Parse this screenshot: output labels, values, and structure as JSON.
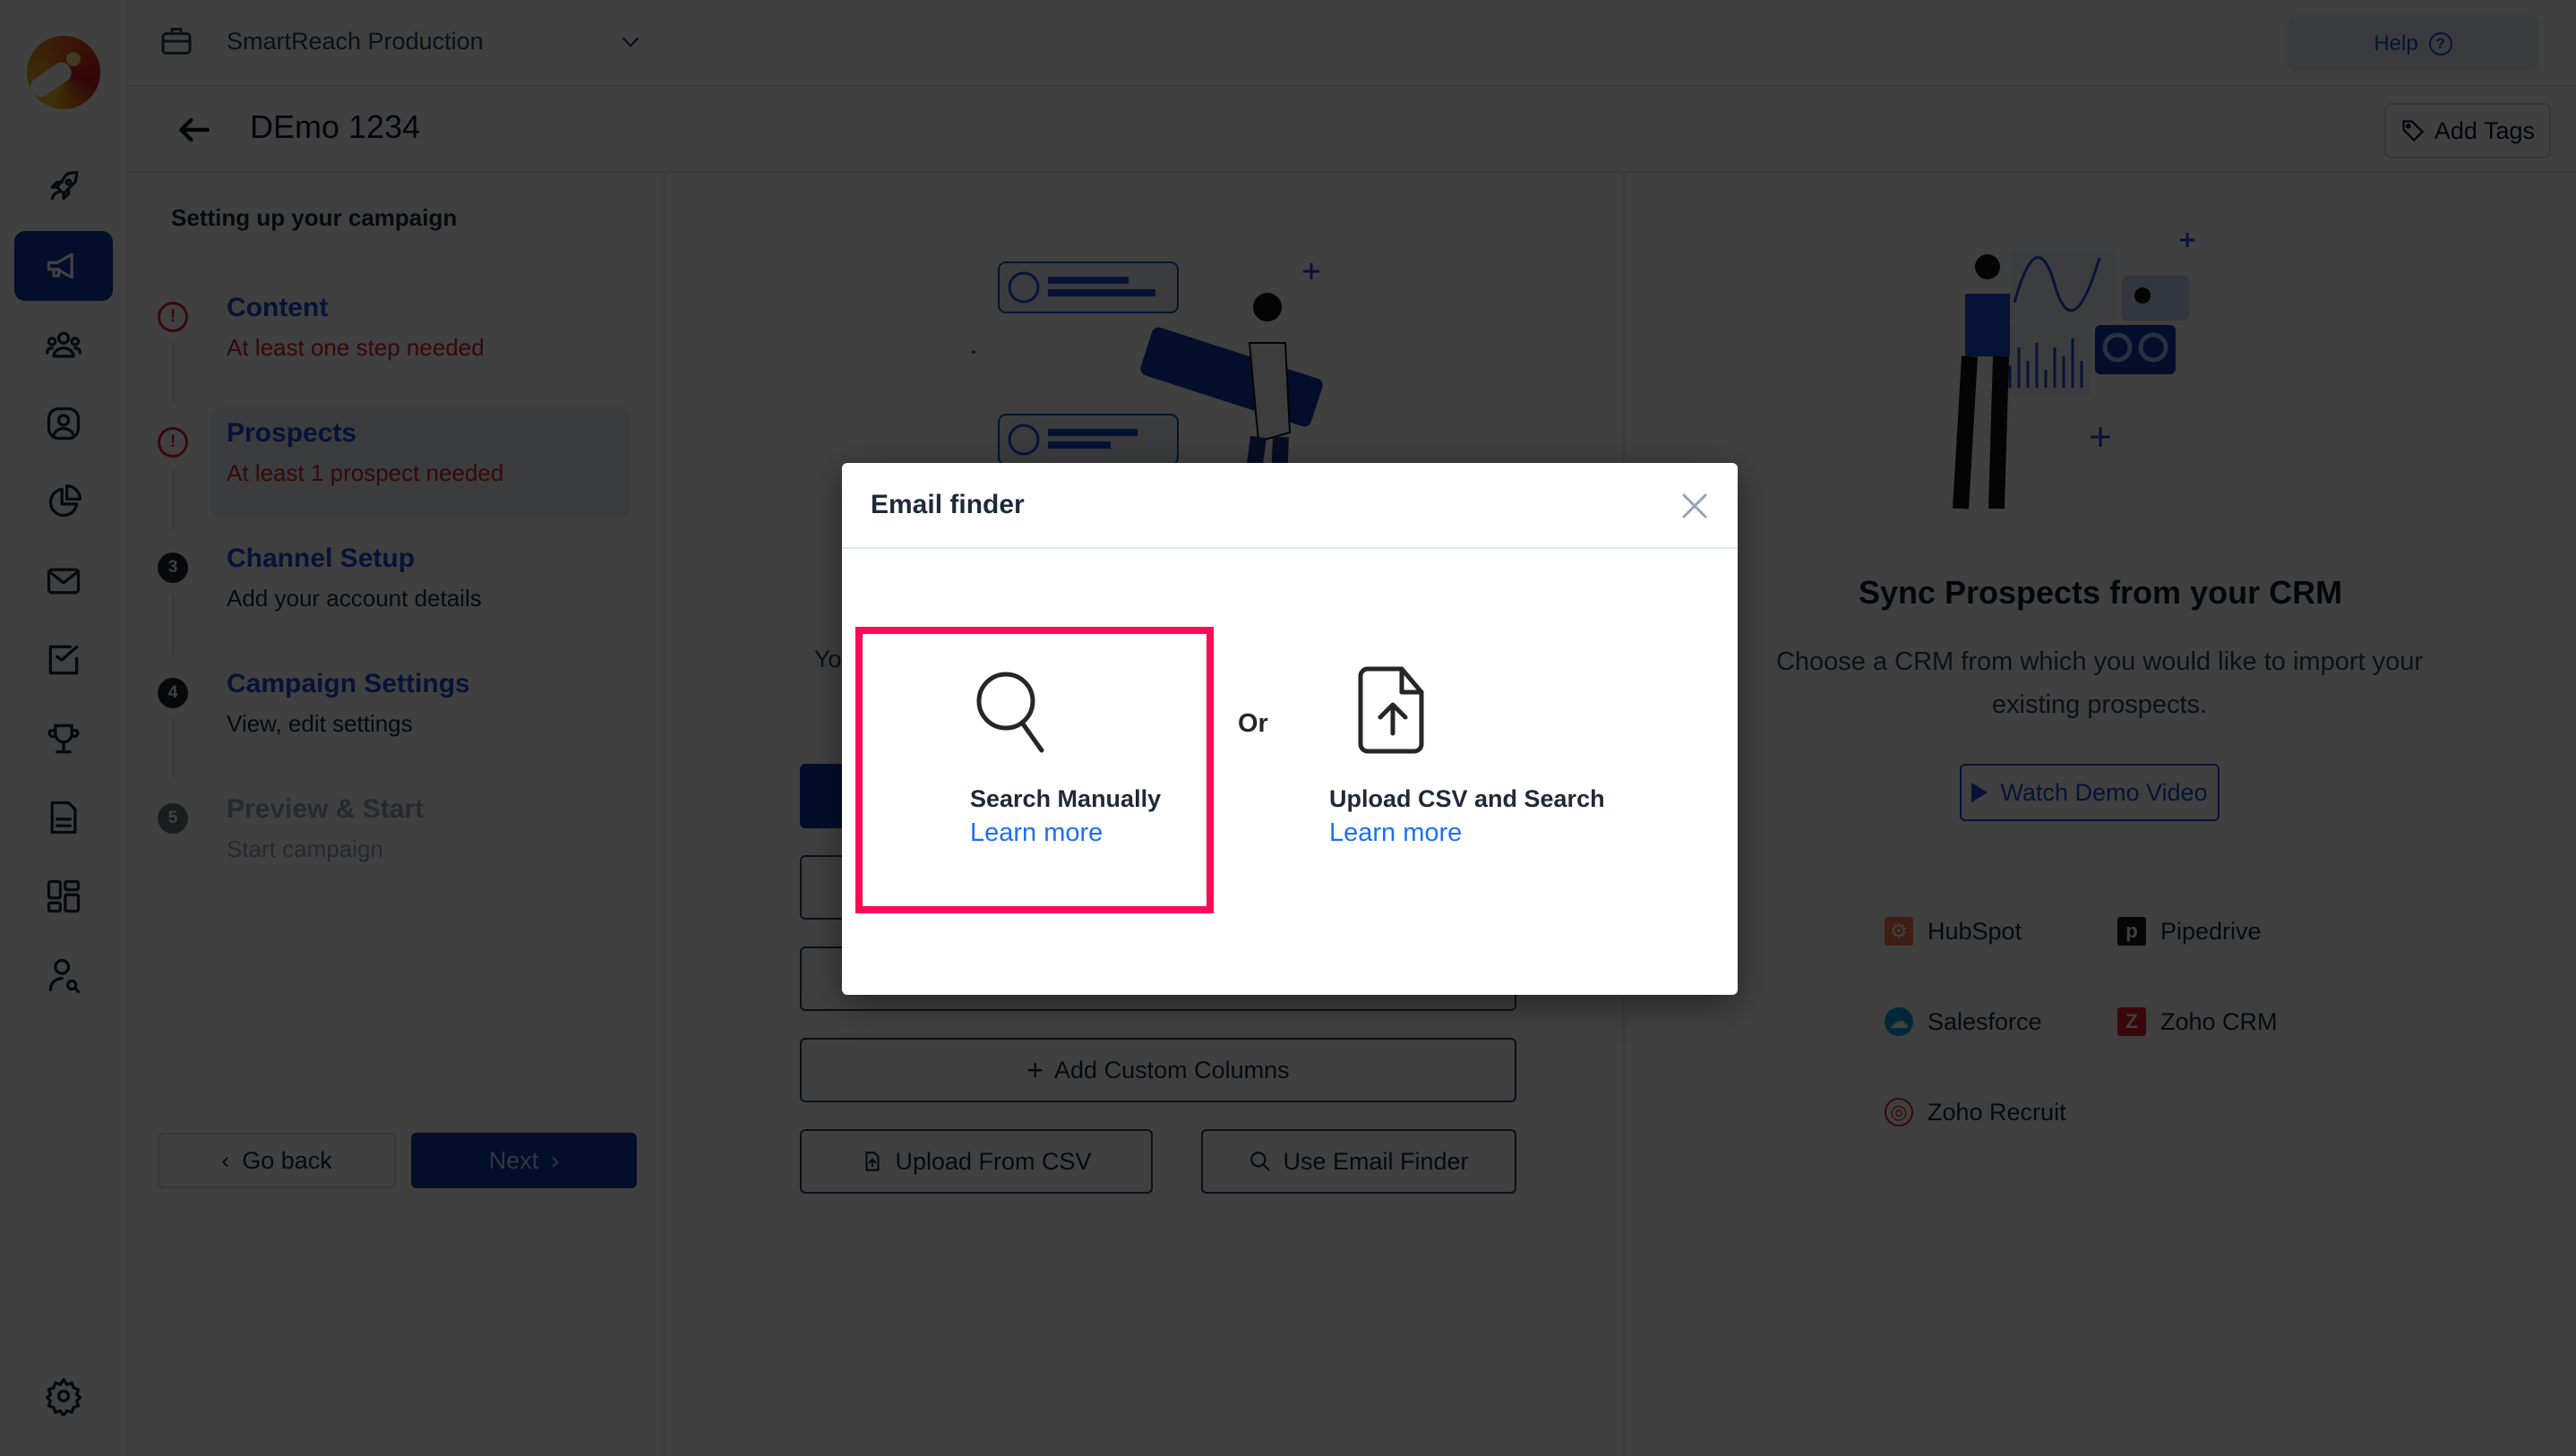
{
  "app": {
    "workspace": "SmartReach Production",
    "help_label": "Help",
    "campaign_title": "DEmo 1234",
    "add_tags_label": "Add Tags"
  },
  "rail": {
    "items": [
      {
        "icon": "rocket-icon",
        "active": false
      },
      {
        "icon": "megaphone-icon",
        "active": true
      },
      {
        "icon": "team-icon",
        "active": false
      },
      {
        "icon": "contact-icon",
        "active": false
      },
      {
        "icon": "pie-chart-icon",
        "active": false
      },
      {
        "icon": "mail-icon",
        "active": false
      },
      {
        "icon": "task-check-icon",
        "active": false
      },
      {
        "icon": "trophy-icon",
        "active": false
      },
      {
        "icon": "document-icon",
        "active": false
      },
      {
        "icon": "dashboard-icon",
        "active": false
      },
      {
        "icon": "user-search-icon",
        "active": false
      }
    ],
    "settings_icon": "gear-icon"
  },
  "steps": {
    "title": "Setting up your campaign",
    "items": [
      {
        "name": "Content",
        "sub": "At least one step needed",
        "status": "error",
        "marker": "!"
      },
      {
        "name": "Prospects",
        "sub": "At least 1 prospect needed",
        "status": "error",
        "marker": "!",
        "current": true
      },
      {
        "name": "Channel Setup",
        "sub": "Add your account details",
        "status": "pending",
        "marker": "3"
      },
      {
        "name": "Campaign Settings",
        "sub": "View, edit settings",
        "status": "pending",
        "marker": "4"
      },
      {
        "name": "Preview & Start",
        "sub": "Start campaign",
        "status": "disabled",
        "marker": "5"
      }
    ],
    "go_back_label": "Go back",
    "next_label": "Next"
  },
  "middle": {
    "partial_text": "Yo",
    "add_custom_columns_label": "Add Custom Columns",
    "upload_csv_label": "Upload From CSV",
    "email_finder_label": "Use Email Finder"
  },
  "crm": {
    "title": "Sync Prospects from your CRM",
    "subtitle": "Choose a CRM from which you would like to import your existing prospects.",
    "demo_label": "Watch Demo Video",
    "providers": [
      {
        "name": "HubSpot",
        "color": "#ff7a59",
        "glyph": "⚙"
      },
      {
        "name": "Pipedrive",
        "color": "#1a1a1a",
        "glyph": "p"
      },
      {
        "name": "Salesforce",
        "color": "#00a1e0",
        "glyph": "☁"
      },
      {
        "name": "Zoho CRM",
        "color": "#e42527",
        "glyph": "Z"
      },
      {
        "name": "Zoho Recruit",
        "color": "#e42527",
        "glyph": "◎"
      }
    ]
  },
  "modal": {
    "title": "Email finder",
    "or_label": "Or",
    "options": [
      {
        "label": "Search Manually",
        "link": "Learn more",
        "highlighted": true
      },
      {
        "label": "Upload CSV and Search",
        "link": "Learn more",
        "highlighted": false
      }
    ]
  },
  "colors": {
    "brand": "#0f3ba8",
    "link": "#1d6ff5",
    "error": "#dc2626",
    "highlight_border": "#ff0a54"
  }
}
